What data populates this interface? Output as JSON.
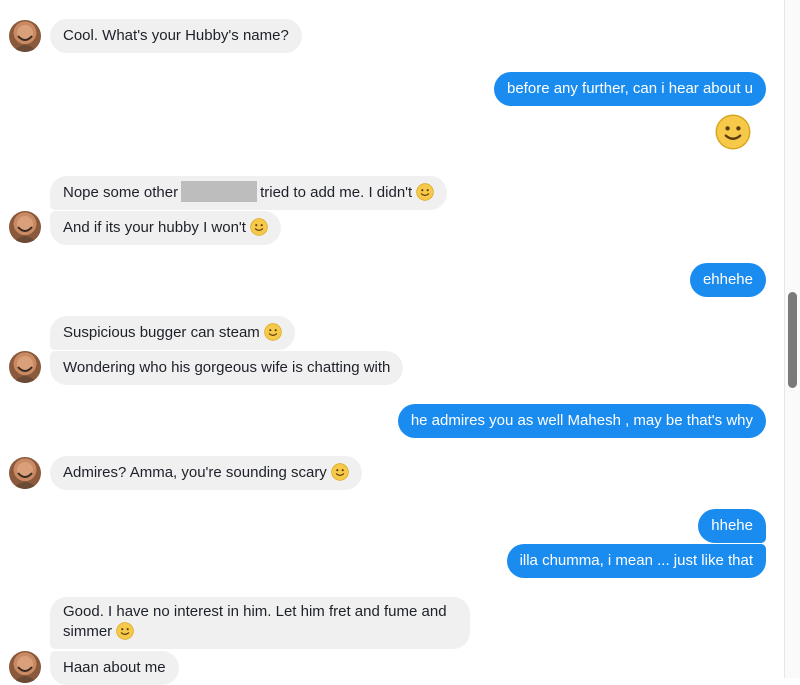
{
  "messages": {
    "m1": "Cool. What's your Hubby's name?",
    "m2": "before any further, can i hear about u",
    "m3_before": "Nope some other",
    "m3_after": "tried to add me. I didn't",
    "m4": "And if its your hubby I won't",
    "m5": "ehhehe",
    "m6": "Suspicious bugger can steam",
    "m7": "Wondering who his gorgeous wife is chatting with",
    "m8": "he admires you as well Mahesh , may be that's why",
    "m9": "Admires? Amma, you're sounding scary",
    "m10": "hhehe",
    "m11": "illa chumma, i mean ... just like that",
    "m12": "Good. I have no interest in him. Let him fret and fume and simmer",
    "m13": "Haan about me"
  },
  "colors": {
    "incoming_bubble": "#f1f0f0",
    "outgoing_bubble": "#1a8cf0",
    "emoji_yellow": "#f7c948"
  },
  "icons": {
    "smiley": "slightly-smiling-face-icon",
    "avatar": "contact-avatar"
  }
}
